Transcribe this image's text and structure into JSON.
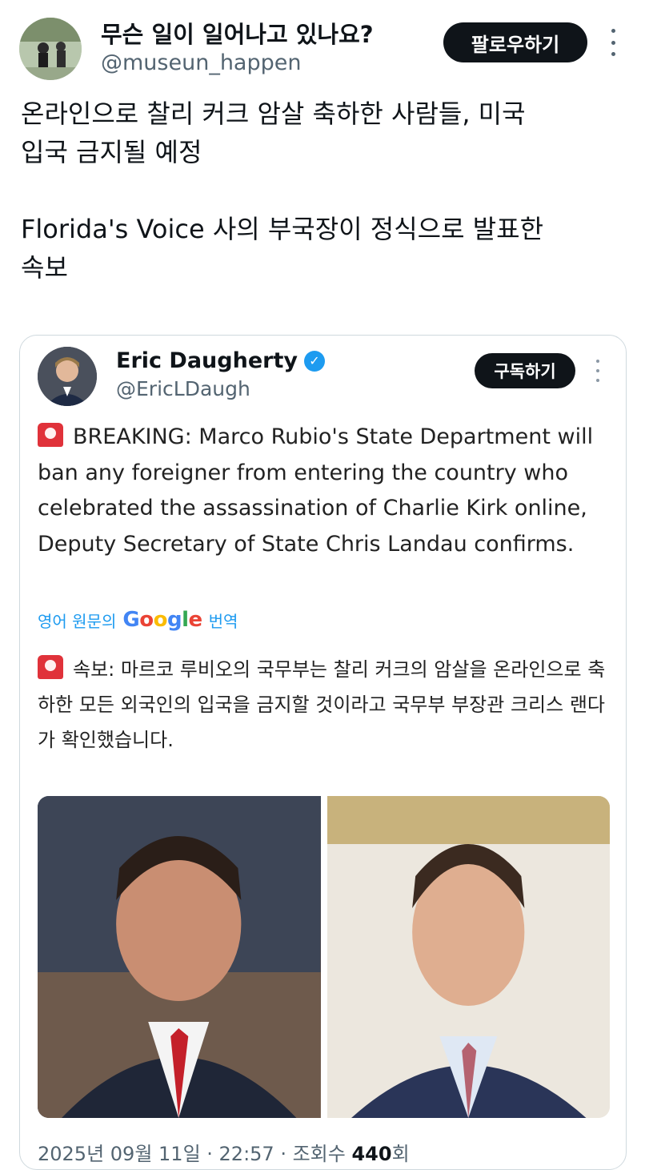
{
  "tweet": {
    "display_name": "무슨 일이 일어나고 있나요?",
    "handle": "@museun_happen",
    "follow_label": "팔로우하기",
    "text_line_1": "온라인으로 찰리 커크 암살 축하한 사람들, 미국",
    "text_line_2": "입국 금지될 예정",
    "text_line_3": "Florida's Voice 사의 부국장이 정식으로 발표한",
    "text_line_4": "속보"
  },
  "quote": {
    "display_name": "Eric Daugherty",
    "handle": "@EricLDaugh",
    "subscribe_label": "구독하기",
    "original_text": "BREAKING: Marco Rubio's State Department will ban any foreigner from entering the country who celebrated the assassination of Charlie Kirk online, Deputy Secretary of State Chris Landau confirms.",
    "translate_prefix": "영어 원문의",
    "translate_brand": "Google",
    "translate_suffix": "번역",
    "translated_text": "속보: 마르코 루비오의 국무부는 찰리 커크의 암살을 온라인으로 축하한 모든 외국인의 입국을 금지할 것이라고 국무부 부장관 크리스 랜다가 확인했습니다.",
    "footer_date": "2025년 09월 11일 · 22:57 · 조회수",
    "footer_views": "440",
    "footer_views_unit": "회"
  },
  "icons": {
    "verified": "verified-badge-icon",
    "siren": "siren-icon",
    "more": "more-options-icon"
  },
  "colors": {
    "accent": "#1d9bf0",
    "button": "#0f1419",
    "muted": "#536471"
  }
}
